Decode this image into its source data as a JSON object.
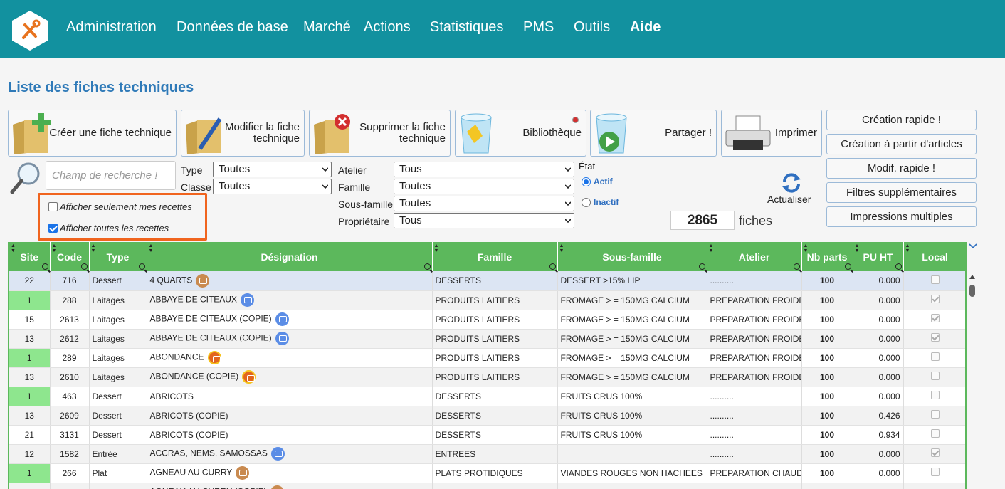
{
  "nav": {
    "items": [
      "Administration",
      "Données de base",
      "Marché",
      "Actions",
      "Statistiques",
      "PMS",
      "Outils",
      "Aide"
    ]
  },
  "page_title": "Liste des fiches techniques",
  "toolbar": {
    "create": "Créer une fiche technique",
    "modify": "Modifier la fiche technique",
    "delete": "Supprimer la fiche technique",
    "library": "Bibliothèque",
    "share": "Partager !",
    "print": "Imprimer"
  },
  "side_buttons": [
    "Création rapide !",
    "Création à partir d'articles",
    "Modif. rapide !",
    "Filtres supplémentaires",
    "Impressions multiples"
  ],
  "filters": {
    "search_placeholder": "Champ de recherche !",
    "type_label": "Type",
    "type_value": "Toutes",
    "classe_label": "Classe",
    "classe_value": "Toutes",
    "atelier_label": "Atelier",
    "atelier_value": "Tous",
    "famille_label": "Famille",
    "famille_value": "Toutes",
    "sousfamille_label": "Sous-famille",
    "sousfamille_value": "Toutes",
    "proprietaire_label": "Propriétaire",
    "proprietaire_value": "Tous",
    "etat_label": "État",
    "actif": "Actif",
    "inactif": "Inactif",
    "refresh": "Actualiser",
    "mine_only": "Afficher seulement mes recettes",
    "all_recipes": "Afficher toutes les recettes",
    "count": "2865",
    "count_label": "fiches"
  },
  "table": {
    "headers": [
      "Site",
      "Code",
      "Type",
      "Désignation",
      "Famille",
      "Sous-famille",
      "Atelier",
      "Nb parts",
      "PU HT",
      "Local"
    ],
    "rows": [
      {
        "site": "22",
        "code": "716",
        "type": "Dessert",
        "name": "4 QUARTS",
        "badge": "brown",
        "famille": "DESSERTS",
        "sous": "DESSERT >15% LIP",
        "atelier": "..........",
        "parts": "100",
        "pu": "0.000",
        "local": false,
        "green": false
      },
      {
        "site": "1",
        "code": "288",
        "type": "Laitages",
        "name": "ABBAYE DE CITEAUX",
        "badge": "blue",
        "famille": "PRODUITS LAITIERS",
        "sous": "FROMAGE > = 150MG CALCIUM",
        "atelier": "PREPARATION FROIDE",
        "parts": "100",
        "pu": "0.000",
        "local": true,
        "green": true
      },
      {
        "site": "15",
        "code": "2613",
        "type": "Laitages",
        "name": "ABBAYE DE CITEAUX (COPIE)",
        "badge": "blue",
        "famille": "PRODUITS LAITIERS",
        "sous": "FROMAGE > = 150MG CALCIUM",
        "atelier": "PREPARATION FROIDE",
        "parts": "100",
        "pu": "0.000",
        "local": true,
        "green": false
      },
      {
        "site": "13",
        "code": "2612",
        "type": "Laitages",
        "name": "ABBAYE DE CITEAUX (COPIE)",
        "badge": "blue",
        "famille": "PRODUITS LAITIERS",
        "sous": "FROMAGE > = 150MG CALCIUM",
        "atelier": "PREPARATION FROIDE",
        "parts": "100",
        "pu": "0.000",
        "local": true,
        "green": false
      },
      {
        "site": "1",
        "code": "289",
        "type": "Laitages",
        "name": "ABONDANCE",
        "badge": "red",
        "famille": "PRODUITS LAITIERS",
        "sous": "FROMAGE > = 150MG CALCIUM",
        "atelier": "PREPARATION FROIDE",
        "parts": "100",
        "pu": "0.000",
        "local": false,
        "green": true
      },
      {
        "site": "13",
        "code": "2610",
        "type": "Laitages",
        "name": "ABONDANCE (COPIE)",
        "badge": "red",
        "famille": "PRODUITS LAITIERS",
        "sous": "FROMAGE > = 150MG CALCIUM",
        "atelier": "PREPARATION FROIDE",
        "parts": "100",
        "pu": "0.000",
        "local": false,
        "green": false
      },
      {
        "site": "1",
        "code": "463",
        "type": "Dessert",
        "name": "ABRICOTS",
        "badge": "",
        "famille": "DESSERTS",
        "sous": "FRUITS CRUS 100%",
        "atelier": "..........",
        "parts": "100",
        "pu": "0.000",
        "local": false,
        "green": true
      },
      {
        "site": "13",
        "code": "2609",
        "type": "Dessert",
        "name": "ABRICOTS (COPIE)",
        "badge": "",
        "famille": "DESSERTS",
        "sous": "FRUITS CRUS 100%",
        "atelier": "..........",
        "parts": "100",
        "pu": "0.426",
        "local": false,
        "green": false
      },
      {
        "site": "21",
        "code": "3131",
        "type": "Dessert",
        "name": "ABRICOTS (COPIE)",
        "badge": "",
        "famille": "DESSERTS",
        "sous": "FRUITS CRUS 100%",
        "atelier": "..........",
        "parts": "100",
        "pu": "0.934",
        "local": false,
        "green": false
      },
      {
        "site": "12",
        "code": "1582",
        "type": "Entrée",
        "name": "ACCRAS, NEMS, SAMOSSAS",
        "badge": "blue",
        "famille": "ENTREES",
        "sous": "",
        "atelier": "..........",
        "parts": "100",
        "pu": "0.000",
        "local": true,
        "green": false
      },
      {
        "site": "1",
        "code": "266",
        "type": "Plat",
        "name": "AGNEAU AU CURRY",
        "badge": "brown",
        "famille": "PLATS PROTIDIQUES",
        "sous": "VIANDES ROUGES NON HACHEES",
        "atelier": "PREPARATION CHAUD",
        "parts": "100",
        "pu": "0.000",
        "local": false,
        "green": true
      },
      {
        "site": "",
        "code": "",
        "type": "",
        "name": "AGNEAU AU CURRY (COPIE)",
        "badge": "brown",
        "famille": "",
        "sous": "",
        "atelier": "",
        "parts": "",
        "pu": "",
        "local": false,
        "green": false
      }
    ]
  }
}
